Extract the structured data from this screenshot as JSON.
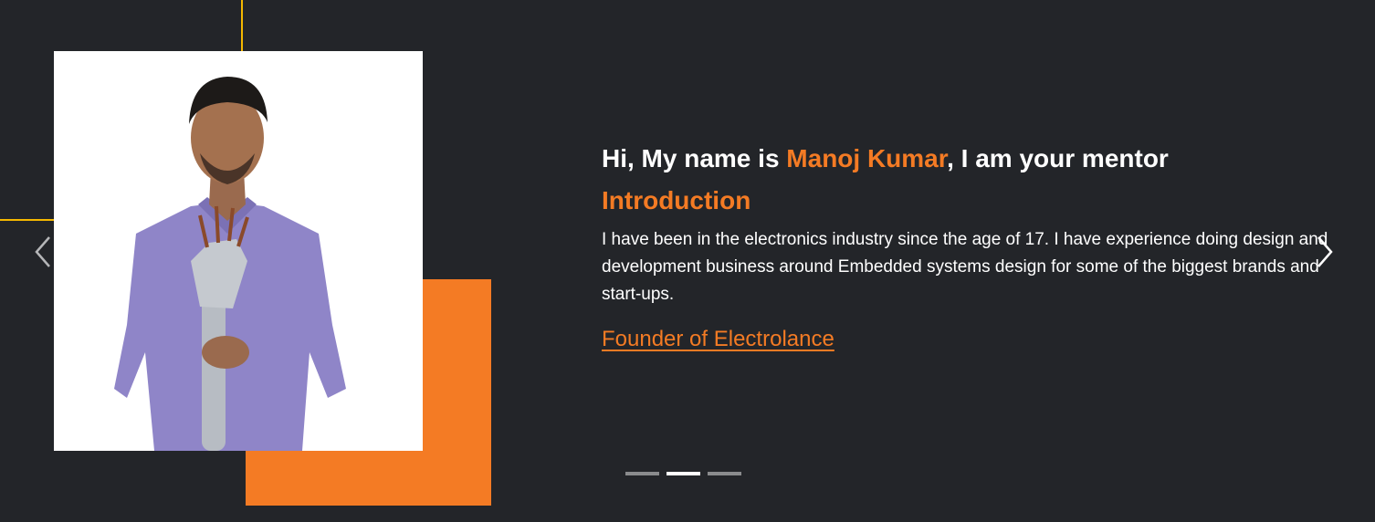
{
  "mentor": {
    "greeting_prefix": "Hi, My name is ",
    "name": "Manoj Kumar",
    "greeting_suffix": ", I am your mentor",
    "section_title": "Introduction",
    "bio": "I have been in the electronics industry since the age of 17. I have experience doing design and development business around Embedded systems design for some of the biggest brands and start-ups.",
    "role_link": "Founder of Electrolance"
  },
  "carousel": {
    "prev_icon": "chevron-left-icon",
    "next_icon": "chevron-right-icon",
    "indicators": [
      {
        "active": false
      },
      {
        "active": true
      },
      {
        "active": false
      }
    ]
  },
  "colors": {
    "background": "#232529",
    "accent": "#f47b24",
    "frame": "#f5b800"
  }
}
